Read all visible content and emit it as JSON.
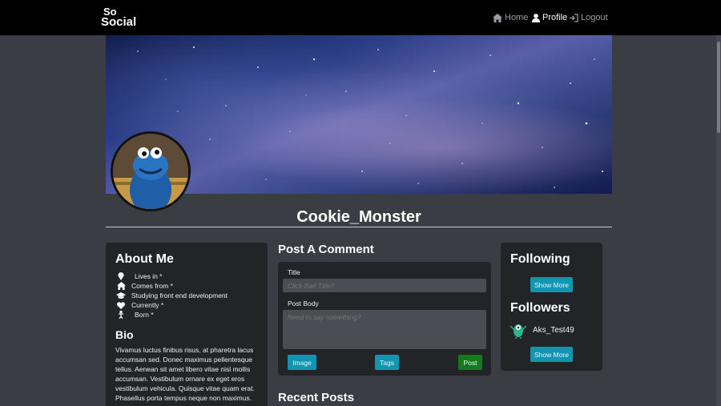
{
  "nav": {
    "logo_line1": "So",
    "logo_line2": "Social",
    "home": "Home",
    "profile": "Profile",
    "logout": "Logout"
  },
  "profile": {
    "username": "Cookie_Monster"
  },
  "about": {
    "title": "About Me",
    "items": [
      {
        "icon": "map-pin-icon",
        "label": "Lives in *"
      },
      {
        "icon": "home-icon",
        "label": "Comes from *"
      },
      {
        "icon": "graduation-cap-icon",
        "label": "Studying front end development"
      },
      {
        "icon": "heart-icon",
        "label": "Currently *"
      },
      {
        "icon": "baby-icon",
        "label": "Born *"
      }
    ],
    "bio_title": "Bio",
    "bio_text": "Vivamus luctus finibus risus, at pharetra lacus accumsan sed. Donec maximus pellentesque tellus. Aenean sit amet libero vitae nisl mollis accumsan. Vestibulum ornare ex eget eros vestibulum vehicula. Quisque vitae quam erat. Phasellus porta tempus neque non maximus."
  },
  "post": {
    "heading": "Post A Comment",
    "title_label": "Title",
    "title_placeholder": "Click Bait Title?",
    "body_label": "Post Body",
    "body_placeholder": "Need to say something?",
    "image_btn": "Image",
    "tags_btn": "Tags",
    "post_btn": "Post"
  },
  "recent": {
    "heading": "Recent Posts"
  },
  "following": {
    "title": "Following",
    "show_more": "Show More"
  },
  "followers": {
    "title": "Followers",
    "items": [
      {
        "name": "Aks_Test49"
      }
    ],
    "show_more": "Show More"
  },
  "colors": {
    "nav_bg": "#000000",
    "page_bg": "#3a3d44",
    "card_bg": "#222428",
    "btn_teal": "#1195b1",
    "btn_green": "#157a1b"
  }
}
